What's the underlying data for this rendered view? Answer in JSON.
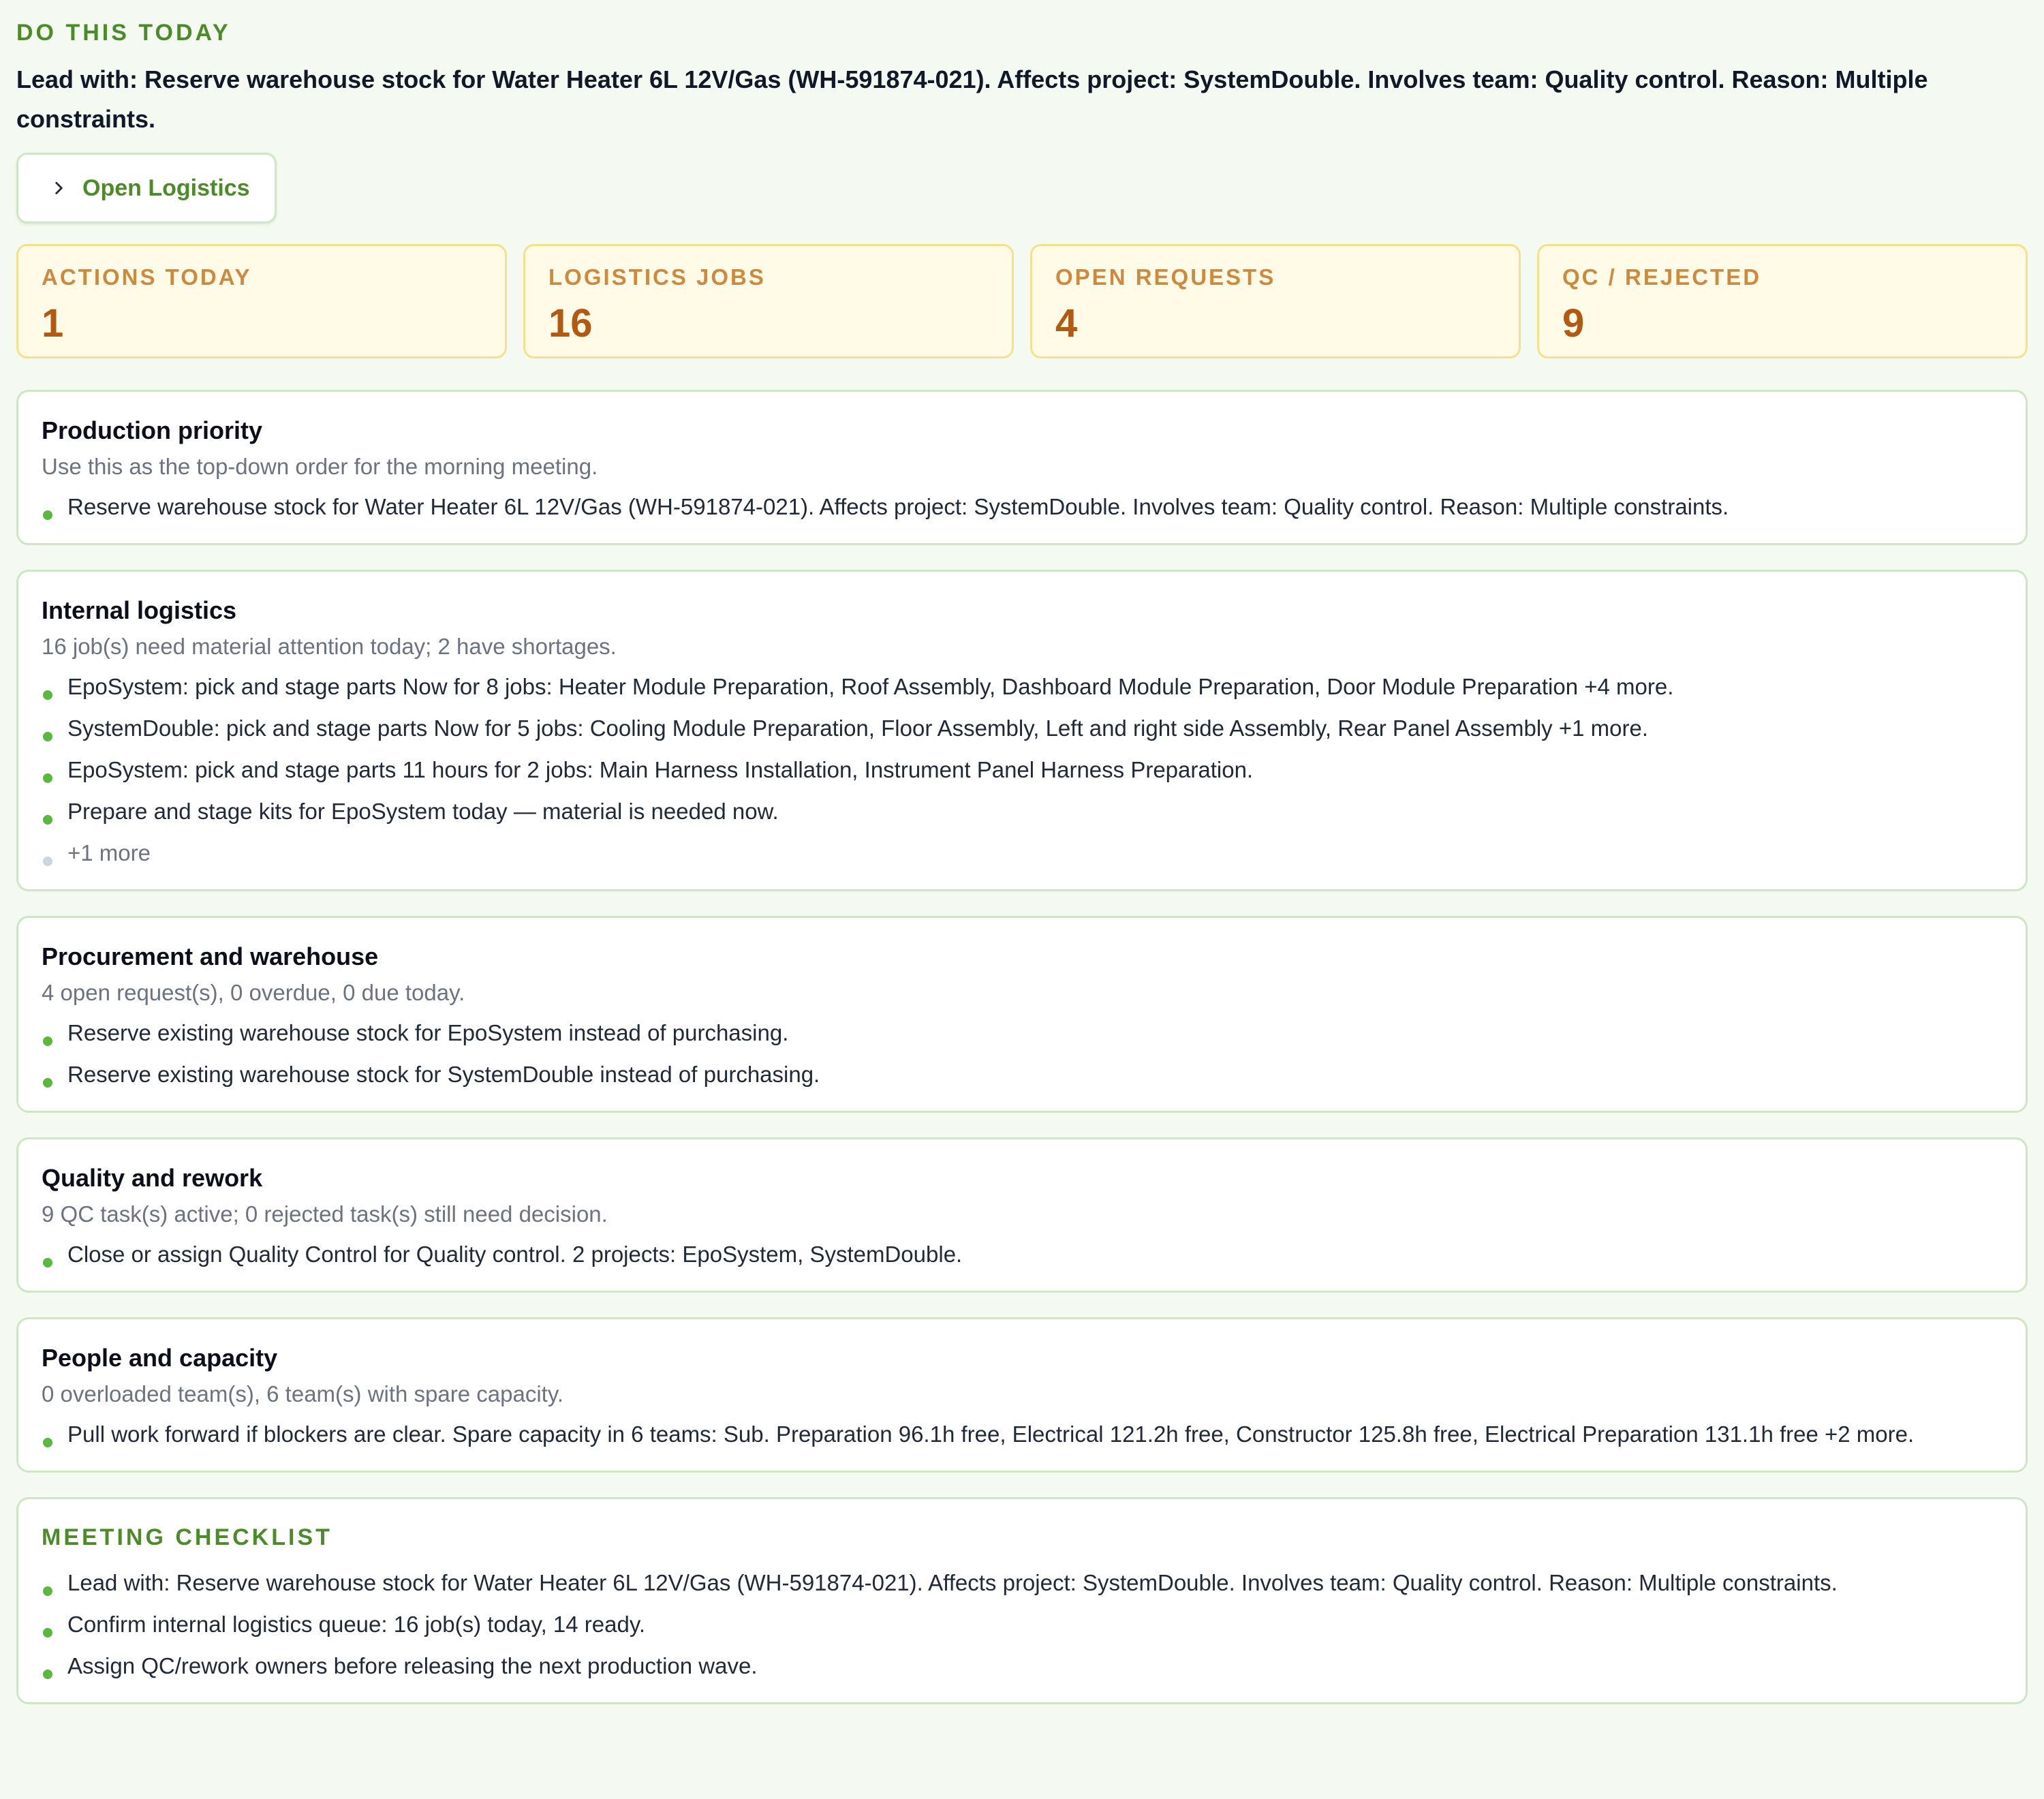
{
  "header": {
    "eyebrow": "DO THIS TODAY",
    "lead": "Lead with: Reserve warehouse stock for Water Heater 6L 12V/Gas (WH-591874-021). Affects project: SystemDouble. Involves team: Quality control. Reason: Multiple constraints.",
    "open_button_label": "Open Logistics",
    "open_button_icon": "chevron-right-icon"
  },
  "kpis": [
    {
      "label": "ACTIONS TODAY",
      "value": "1"
    },
    {
      "label": "LOGISTICS JOBS",
      "value": "16"
    },
    {
      "label": "OPEN REQUESTS",
      "value": "4"
    },
    {
      "label": "QC / REJECTED",
      "value": "9"
    }
  ],
  "cards": {
    "production": {
      "title": "Production priority",
      "subtitle": "Use this as the top-down order for the morning meeting.",
      "items": [
        "Reserve warehouse stock for Water Heater 6L 12V/Gas (WH-591874-021). Affects project: SystemDouble. Involves team: Quality control. Reason: Multiple constraints."
      ]
    },
    "logistics": {
      "title": "Internal logistics",
      "subtitle": "16 job(s) need material attention today; 2 have shortages.",
      "items": [
        "EpoSystem: pick and stage parts Now for 8 jobs: Heater Module Preparation, Roof Assembly, Dashboard Module Preparation, Door Module Preparation +4 more.",
        "SystemDouble: pick and stage parts Now for 5 jobs: Cooling Module Preparation, Floor Assembly, Left and right side Assembly, Rear Panel Assembly +1 more.",
        "EpoSystem: pick and stage parts 11 hours for 2 jobs: Main Harness Installation, Instrument Panel Harness Preparation.",
        "Prepare and stage kits for EpoSystem today — material is needed now."
      ],
      "more": "+1 more"
    },
    "procurement": {
      "title": "Procurement and warehouse",
      "subtitle": "4 open request(s), 0 overdue, 0 due today.",
      "items": [
        "Reserve existing warehouse stock for EpoSystem instead of purchasing.",
        "Reserve existing warehouse stock for SystemDouble instead of purchasing."
      ]
    },
    "quality": {
      "title": "Quality and rework",
      "subtitle": "9 QC task(s) active; 0 rejected task(s) still need decision.",
      "items": [
        "Close or assign Quality Control for Quality control. 2 projects: EpoSystem, SystemDouble."
      ]
    },
    "people": {
      "title": "People and capacity",
      "subtitle": "0 overloaded team(s), 6 team(s) with spare capacity.",
      "items": [
        "Pull work forward if blockers are clear. Spare capacity in 6 teams: Sub. Preparation 96.1h free, Electrical 121.2h free, Constructor 125.8h free, Electrical Preparation 131.1h free +2 more."
      ]
    }
  },
  "checklist": {
    "title": "MEETING CHECKLIST",
    "items": [
      "Lead with: Reserve warehouse stock for Water Heater 6L 12V/Gas (WH-591874-021). Affects project: SystemDouble. Involves team: Quality control. Reason: Multiple constraints.",
      "Confirm internal logistics queue: 16 job(s) today, 14 ready.",
      "Assign QC/rework owners before releasing the next production wave."
    ]
  },
  "colors": {
    "accent_green": "#4c8a2a",
    "bullet_green": "#5ab83e",
    "kpi_value": "#b35a12",
    "kpi_label": "#cd8a3f",
    "kpi_bg": "#fffbe6",
    "page_bg": "#f4f9f1"
  }
}
